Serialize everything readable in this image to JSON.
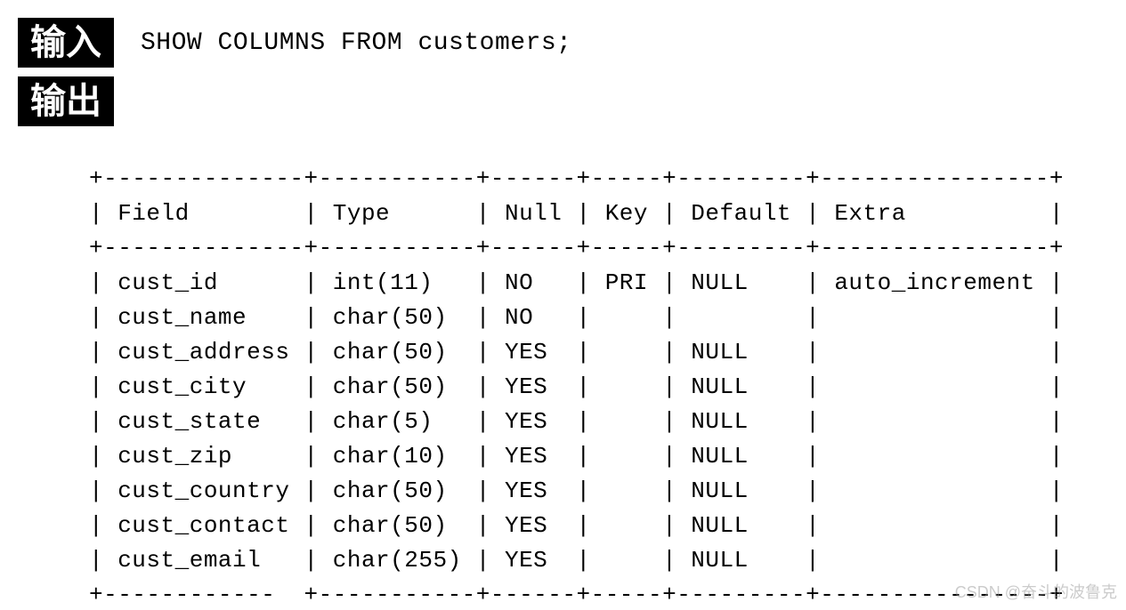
{
  "labels": {
    "input": "输入",
    "output": "输出"
  },
  "command": "SHOW COLUMNS FROM customers;",
  "table": {
    "headers": [
      "Field",
      "Type",
      "Null",
      "Key",
      "Default",
      "Extra"
    ],
    "rows": [
      {
        "Field": "cust_id",
        "Type": "int(11)",
        "Null": "NO",
        "Key": "PRI",
        "Default": "NULL",
        "Extra": "auto_increment"
      },
      {
        "Field": "cust_name",
        "Type": "char(50)",
        "Null": "NO",
        "Key": "",
        "Default": "",
        "Extra": ""
      },
      {
        "Field": "cust_address",
        "Type": "char(50)",
        "Null": "YES",
        "Key": "",
        "Default": "NULL",
        "Extra": ""
      },
      {
        "Field": "cust_city",
        "Type": "char(50)",
        "Null": "YES",
        "Key": "",
        "Default": "NULL",
        "Extra": ""
      },
      {
        "Field": "cust_state",
        "Type": "char(5)",
        "Null": "YES",
        "Key": "",
        "Default": "NULL",
        "Extra": ""
      },
      {
        "Field": "cust_zip",
        "Type": "char(10)",
        "Null": "YES",
        "Key": "",
        "Default": "NULL",
        "Extra": ""
      },
      {
        "Field": "cust_country",
        "Type": "char(50)",
        "Null": "YES",
        "Key": "",
        "Default": "NULL",
        "Extra": ""
      },
      {
        "Field": "cust_contact",
        "Type": "char(50)",
        "Null": "YES",
        "Key": "",
        "Default": "NULL",
        "Extra": ""
      },
      {
        "Field": "cust_email",
        "Type": "char(255)",
        "Null": "YES",
        "Key": "",
        "Default": "NULL",
        "Extra": ""
      }
    ],
    "col_widths": {
      "Field": 14,
      "Type": 11,
      "Null": 6,
      "Key": 5,
      "Default": 9,
      "Extra": 16
    },
    "bottom_border_first_gap": true
  },
  "watermark": "CSDN @奋斗的波鲁克"
}
